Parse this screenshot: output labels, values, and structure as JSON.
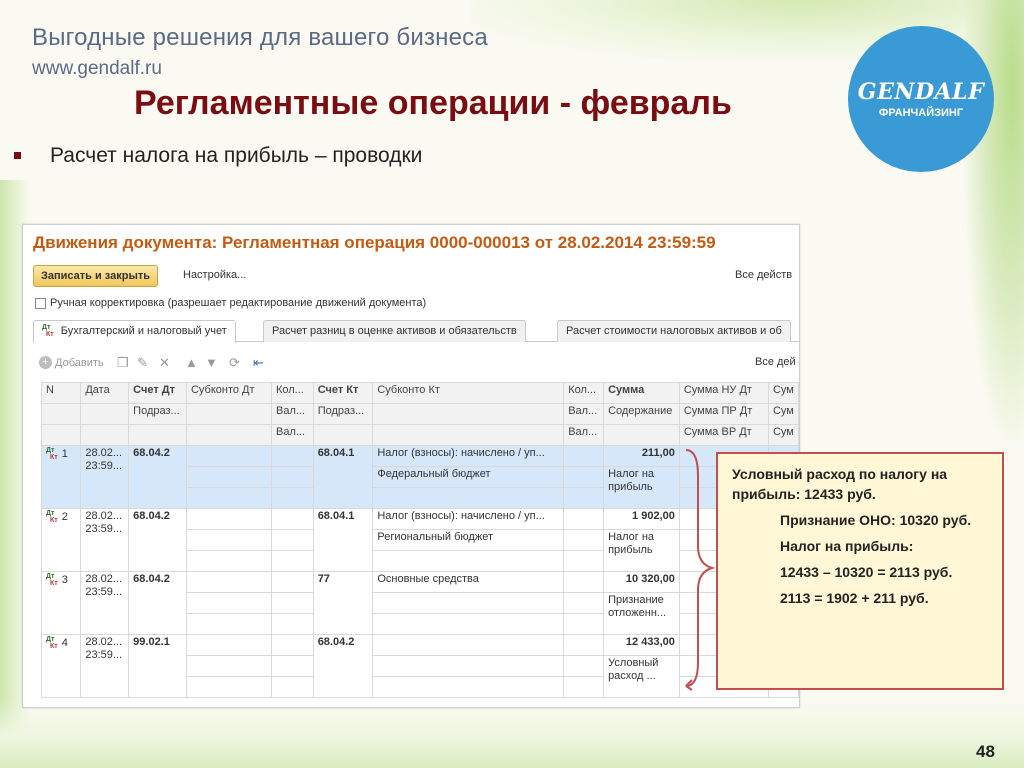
{
  "header": {
    "slogan": "Выгодные решения для вашего бизнеса",
    "site": "www.gendalf.ru",
    "logo_brand": "GENDALF",
    "logo_sub": "ФРАНЧАЙЗИНГ"
  },
  "slide": {
    "title": "Регламентные операции - февраль",
    "subtitle": "Расчет налога на прибыль – проводки",
    "page_number": "48"
  },
  "window": {
    "title": "Движения документа: Регламентная операция 0000-000013 от 28.02.2014 23:59:59",
    "save_close": "Записать и закрыть",
    "settings": "Настройка...",
    "all_actions": "Все действ",
    "manual_correction": "Ручная корректировка (разрешает редактирование движений документа)",
    "tabs": [
      "Бухгалтерский и налоговый учет",
      "Расчет разниц в оценке активов и обязательств",
      "Расчет стоимости налоговых активов и об"
    ],
    "dt": "Дт",
    "kt": "Кт",
    "add": "Добавить",
    "all_actions2": "Все дей"
  },
  "table": {
    "header_row1": [
      "N",
      "Дата",
      "Счет Дт",
      "Субконто Дт",
      "Кол...",
      "Счет Кт",
      "Субконто Кт",
      "Кол...",
      "Сумма",
      "Сумма НУ Дт",
      "Сум"
    ],
    "header_row2": [
      "Подраз...",
      "Вал...",
      "Подраз...",
      "Вал...",
      "Содержание",
      "Сумма ПР Дт",
      "Сум"
    ],
    "header_row3": [
      "Вал...",
      "Вал...",
      "Сумма ВР Дт",
      "Сум"
    ],
    "rows": [
      {
        "n": "1",
        "date": "28.02...",
        "time": "23:59...",
        "dt": "68.04.2",
        "kt": "68.04.1",
        "sub1": "Налог (взносы): начислено / уп...",
        "sub2": "Федеральный бюджет",
        "sum": "211,00",
        "content1": "Налог на",
        "content2": "прибыль"
      },
      {
        "n": "2",
        "date": "28.02...",
        "time": "23:59...",
        "dt": "68.04.2",
        "kt": "68.04.1",
        "sub1": "Налог (взносы): начислено / уп...",
        "sub2": "Региональный бюджет",
        "sum": "1 902,00",
        "content1": "Налог на",
        "content2": "прибыль"
      },
      {
        "n": "3",
        "date": "28.02...",
        "time": "23:59...",
        "dt": "68.04.2",
        "kt": "77",
        "sub1": "Основные средства",
        "sub2": "",
        "sum": "10 320,00",
        "content1": "Признание",
        "content2": "отложенн..."
      },
      {
        "n": "4",
        "date": "28.02...",
        "time": "23:59...",
        "dt": "99.02.1",
        "kt": "68.04.2",
        "sub1": "",
        "sub2": "",
        "sum": "12 433,00",
        "content1": "Условный",
        "content2": "расход ..."
      }
    ]
  },
  "note": {
    "line1": "Условный расход по налогу на прибыль: 12433 руб.",
    "line2": "Признание ОНО: 10320 руб.",
    "line3": "Налог на прибыль:",
    "line4": "12433 – 10320 = 2113 руб.",
    "line5": "2113 = 1902 + 211 руб."
  },
  "colors": {
    "title": "#7a0d12",
    "window_title": "#c55a11",
    "logo": "#3a9ad6",
    "note_border": "#c0504d",
    "selected_row": "#d6e7fa"
  }
}
